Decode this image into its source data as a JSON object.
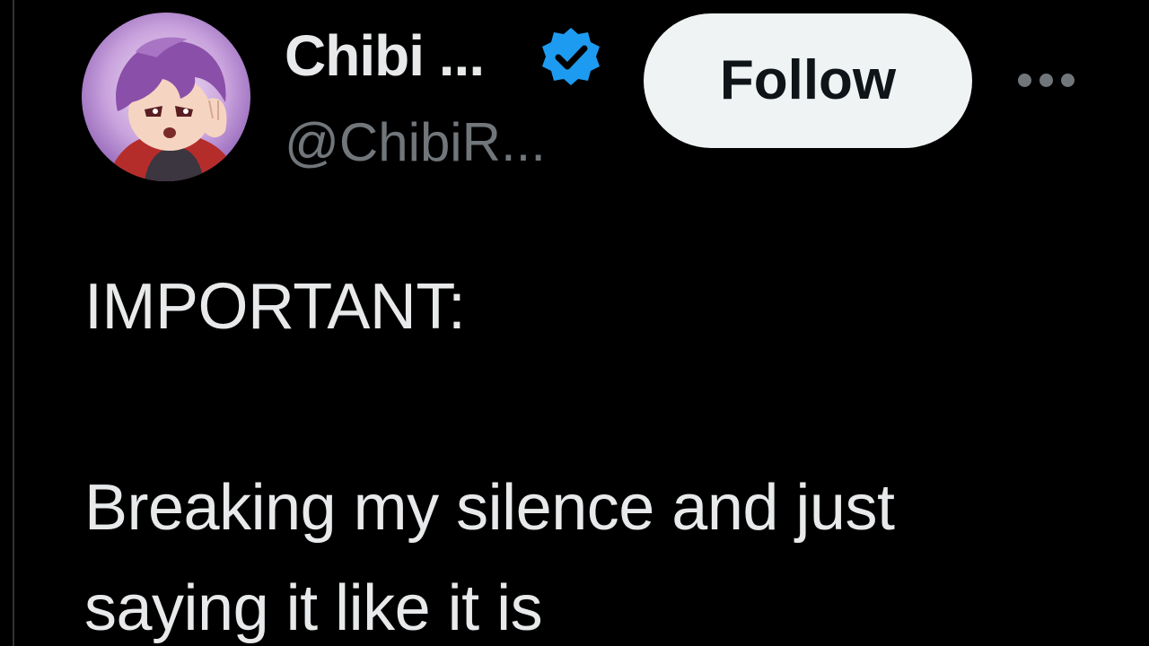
{
  "author": {
    "display_name": "Chibi ...",
    "handle": "@ChibiR...",
    "verified_icon": "verified-badge-icon",
    "badge_color": "#1d9bf0"
  },
  "actions": {
    "follow_label": "Follow",
    "more_icon": "more-horizontal-icon"
  },
  "tweet": {
    "heading": "IMPORTANT:",
    "body": "Breaking my silence and just\nsaying it like it is"
  },
  "colors": {
    "background": "#000000",
    "primary_text": "#e7e9ea",
    "secondary_text": "#71767b",
    "button_bg": "#eff3f4"
  }
}
